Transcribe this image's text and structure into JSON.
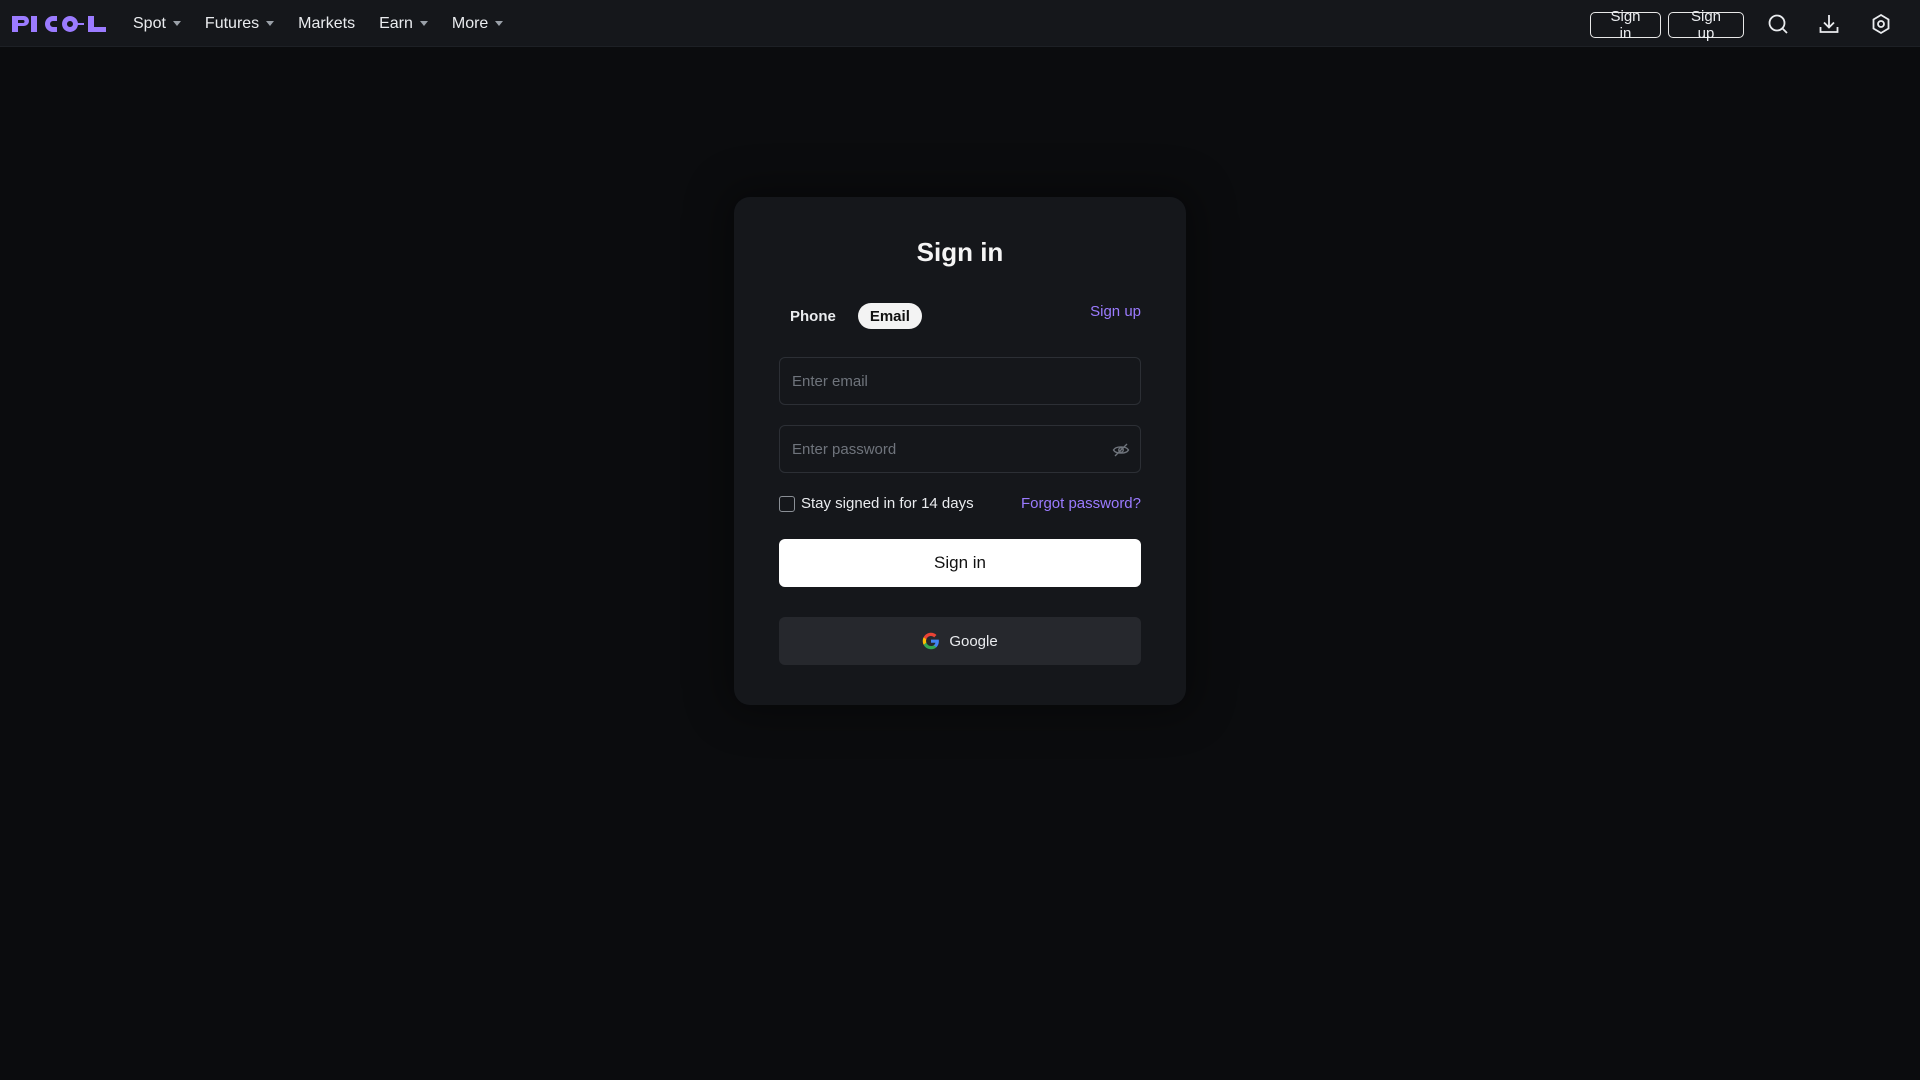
{
  "brand": {
    "logo_text": "PICOL",
    "accent_color": "#9b7bff"
  },
  "nav": {
    "items": [
      {
        "label": "Spot",
        "has_dropdown": true
      },
      {
        "label": "Futures",
        "has_dropdown": true
      },
      {
        "label": "Markets",
        "has_dropdown": false
      },
      {
        "label": "Earn",
        "has_dropdown": true
      },
      {
        "label": "More",
        "has_dropdown": true
      }
    ],
    "sign_in_label": "Sign in",
    "sign_up_label": "Sign up",
    "icons": [
      "search-icon",
      "download-icon",
      "settings-icon"
    ]
  },
  "signin_card": {
    "title": "Sign in",
    "tabs": [
      {
        "label": "Phone",
        "active": false
      },
      {
        "label": "Email",
        "active": true
      }
    ],
    "signup_link": "Sign up",
    "email_placeholder": "Enter email",
    "email_value": "",
    "password_placeholder": "Enter password",
    "password_value": "",
    "remember_label": "Stay signed in for 14 days",
    "remember_checked": false,
    "forgot_link": "Forgot password?",
    "submit_label": "Sign in",
    "google_label": "Google"
  }
}
